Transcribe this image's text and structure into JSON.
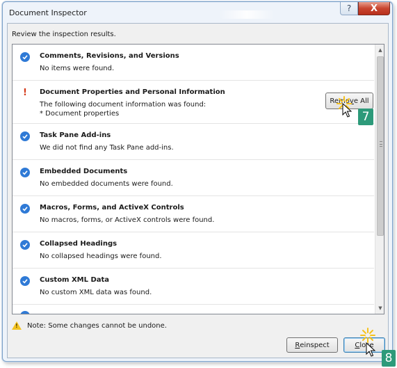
{
  "window": {
    "title": "Document Inspector",
    "help_glyph": "?",
    "close_glyph": "X"
  },
  "review_text": "Review the inspection results.",
  "items": [
    {
      "heading": "Comments, Revisions, and Versions",
      "desc": "No items were found.",
      "status": "ok"
    },
    {
      "heading": "Document Properties and Personal Information",
      "desc": "The following document information was found:\n* Document properties",
      "status": "found",
      "status_glyph": "!"
    },
    {
      "heading": "Task Pane Add-ins",
      "desc": "We did not find any Task Pane add-ins.",
      "status": "ok"
    },
    {
      "heading": "Embedded Documents",
      "desc": "No embedded documents were found.",
      "status": "ok"
    },
    {
      "heading": "Macros, Forms, and ActiveX Controls",
      "desc": "No macros, forms, or ActiveX controls were found.",
      "status": "ok"
    },
    {
      "heading": "Collapsed Headings",
      "desc": "No collapsed headings were found.",
      "status": "ok"
    },
    {
      "heading": "Custom XML Data",
      "desc": "No custom XML data was found.",
      "status": "ok"
    }
  ],
  "remove_all_label_pre": "Remo",
  "remove_all_label_u": "v",
  "remove_all_label_post": "e All",
  "note": "Note: Some changes cannot be undone.",
  "buttons": {
    "reinspect_u": "R",
    "reinspect_rest": "einspect",
    "close_u": "C",
    "close_rest": "lose"
  },
  "callouts": {
    "step_remove": "7",
    "step_close": "8"
  },
  "colors": {
    "accent": "#2f7ad6",
    "warning": "#d43a1a",
    "callout": "#2d9a7a"
  },
  "icons": {
    "ok": "checkmark-circle-icon",
    "found": "exclamation-icon",
    "note": "warning-triangle-icon"
  }
}
